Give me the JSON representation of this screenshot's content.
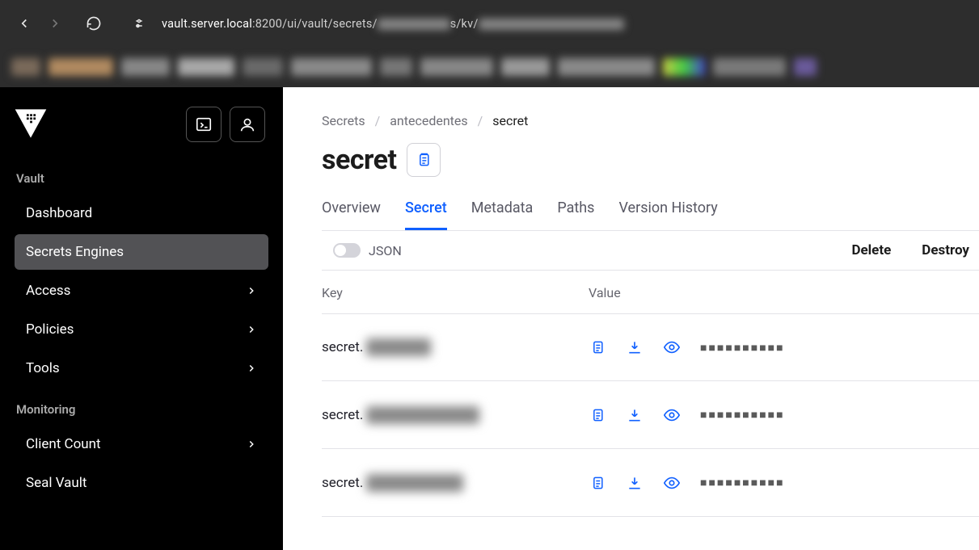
{
  "browser": {
    "url_prefix": "vault.server.local",
    "url_port": ":8200",
    "url_path": "/ui/vault/secrets/",
    "url_mid": "s/kv/"
  },
  "sidebar": {
    "sections": {
      "vault_label": "Vault",
      "monitoring_label": "Monitoring"
    },
    "items": {
      "dashboard": "Dashboard",
      "secrets_engines": "Secrets Engines",
      "access": "Access",
      "policies": "Policies",
      "tools": "Tools",
      "client_count": "Client Count",
      "seal_vault": "Seal Vault"
    }
  },
  "breadcrumbs": {
    "root": "Secrets",
    "mid": "antecedentes",
    "current": "secret"
  },
  "page": {
    "title": "secret"
  },
  "tabs": {
    "overview": "Overview",
    "secret": "Secret",
    "metadata": "Metadata",
    "paths": "Paths",
    "version_history": "Version History"
  },
  "actionbar": {
    "json_label": "JSON",
    "delete": "Delete",
    "destroy": "Destroy"
  },
  "table": {
    "key_header": "Key",
    "value_header": "Value",
    "rows": [
      {
        "prefix": "secret.",
        "masked": "■■■■■■■■■■"
      },
      {
        "prefix": "secret.",
        "masked": "■■■■■■■■■■"
      },
      {
        "prefix": "secret.",
        "masked": "■■■■■■■■■■"
      }
    ]
  }
}
